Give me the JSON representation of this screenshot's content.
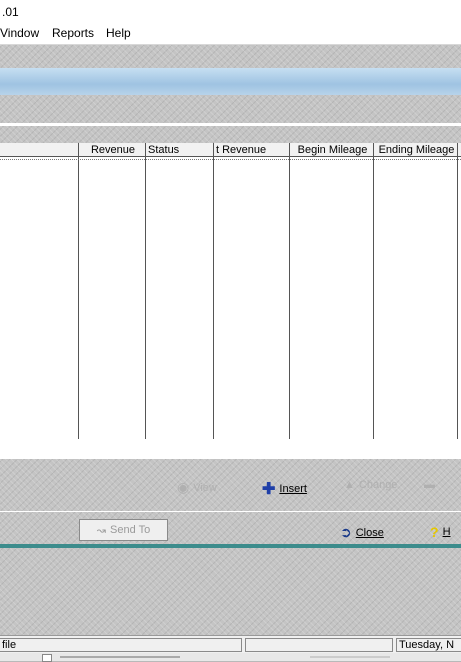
{
  "window": {
    "title": ".01"
  },
  "menu": [
    "Vindow",
    "Reports",
    "Help"
  ],
  "grid": {
    "columns": [
      "Revenue",
      "Status",
      "t Revenue",
      "Begin Mileage",
      "Ending Mileage"
    ]
  },
  "toolbar": {
    "view_label": "View",
    "insert_label": "Insert",
    "change_label": "Change"
  },
  "actions": {
    "send_label": "Send To",
    "close_label": "Close",
    "help_label": "H"
  },
  "statusbar": {
    "left": "file",
    "date": "Tuesday, N"
  },
  "taskbar": {
    "text": ""
  }
}
